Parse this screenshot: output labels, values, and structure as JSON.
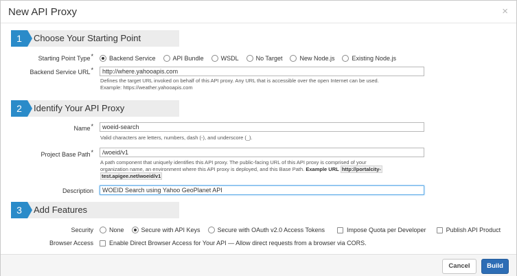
{
  "dialog": {
    "title": "New API Proxy",
    "close": "×"
  },
  "sections": [
    {
      "num": "1",
      "label": "Choose Your Starting Point"
    },
    {
      "num": "2",
      "label": "Identify Your API Proxy"
    },
    {
      "num": "3",
      "label": "Add Features"
    }
  ],
  "starting_point": {
    "label": "Starting Point Type",
    "required": "*",
    "options": [
      "Backend Service",
      "API Bundle",
      "WSDL",
      "No Target",
      "New Node.js",
      "Existing Node.js"
    ],
    "selected": "Backend Service"
  },
  "backend_url": {
    "label": "Backend Service URL",
    "required": "*",
    "value": "http://where.yahooapis.com",
    "help_line1": "Defines the target URL invoked on behalf of this API proxy. Any URL that is accessible over the open Internet can be used.",
    "help_line2": "Example: https://weather.yahooapis.com"
  },
  "name": {
    "label": "Name",
    "required": "*",
    "value": "woeid-search",
    "help": "Valid characters are letters, numbers, dash (-), and underscore (_)."
  },
  "base_path": {
    "label": "Project Base Path",
    "required": "*",
    "value": "/woeid/v1",
    "help_line1": "A path component that uniquely identifies this API proxy. The public-facing URL of this API proxy is comprised of your",
    "help_line2": "organization name, an environment where this API proxy is deployed, and this Base Path.",
    "example_label": "Example URL",
    "example_url_1": "http://portalcity-",
    "example_url_2": "test.apigee.net/woeid/v1"
  },
  "description": {
    "label": "Description",
    "value": "WOEID Search using Yahoo GeoPlanet API"
  },
  "security": {
    "label": "Security",
    "options": [
      "None",
      "Secure with API Keys",
      "Secure with OAuth v2.0 Access Tokens"
    ],
    "selected": "Secure with API Keys",
    "checks": [
      "Impose Quota per Developer",
      "Publish API Product"
    ]
  },
  "browser_access": {
    "label": "Browser Access",
    "check_label": "Enable Direct Browser Access for Your API — Allow direct requests from a browser via CORS."
  },
  "footer": {
    "cancel": "Cancel",
    "build": "Build"
  },
  "colors": {
    "accent": "#2a8bc9",
    "primary_button": "#2d6db5"
  }
}
